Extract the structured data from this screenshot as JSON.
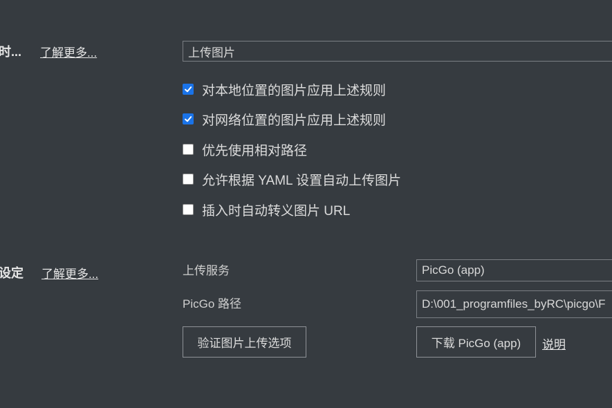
{
  "insert_section": {
    "label": "时...",
    "learn_more": "了解更多...",
    "action_select_value": "上传图片",
    "checkboxes": [
      {
        "label": "对本地位置的图片应用上述规则",
        "checked": true
      },
      {
        "label": "对网络位置的图片应用上述规则",
        "checked": true
      },
      {
        "label": "优先使用相对路径",
        "checked": false
      },
      {
        "label": "允许根据 YAML 设置自动上传图片",
        "checked": false
      },
      {
        "label": "插入时自动转义图片 URL",
        "checked": false
      }
    ]
  },
  "upload_section": {
    "label": "设定",
    "learn_more": "了解更多...",
    "service_label": "上传服务",
    "service_value": "PicGo (app)",
    "path_label": "PicGo 路径",
    "path_value": "D:\\001_programfiles_byRC\\picgo\\F",
    "verify_button": "验证图片上传选项",
    "download_button": "下载 PicGo (app)",
    "help_link": "说明"
  },
  "colors": {
    "background": "#363b40",
    "checkbox_checked": "#1a73e8"
  }
}
